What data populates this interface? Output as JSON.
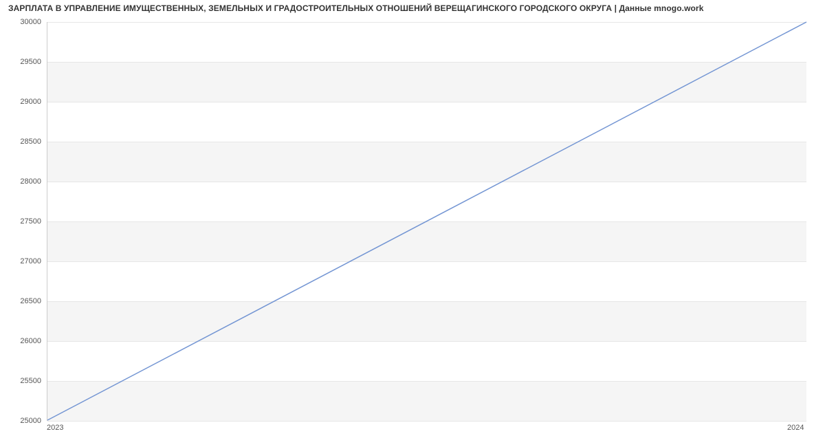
{
  "chart_data": {
    "type": "line",
    "title": "ЗАРПЛАТА В УПРАВЛЕНИЕ ИМУЩЕСТВЕННЫХ, ЗЕМЕЛЬНЫХ И ГРАДОСТРОИТЕЛЬНЫХ ОТНОШЕНИЙ ВЕРЕЩАГИНСКОГО ГОРОДСКОГО ОКРУГА | Данные mnogo.work",
    "xlabel": "",
    "ylabel": "",
    "x_categories": [
      "2023",
      "2024"
    ],
    "values": [
      25000,
      30000
    ],
    "y_ticks": [
      25000,
      25500,
      26000,
      26500,
      27000,
      27500,
      28000,
      28500,
      29000,
      29500,
      30000
    ],
    "ylim": [
      25000,
      30000
    ],
    "grid": true,
    "legend": false,
    "line_color": "#7395d3"
  }
}
